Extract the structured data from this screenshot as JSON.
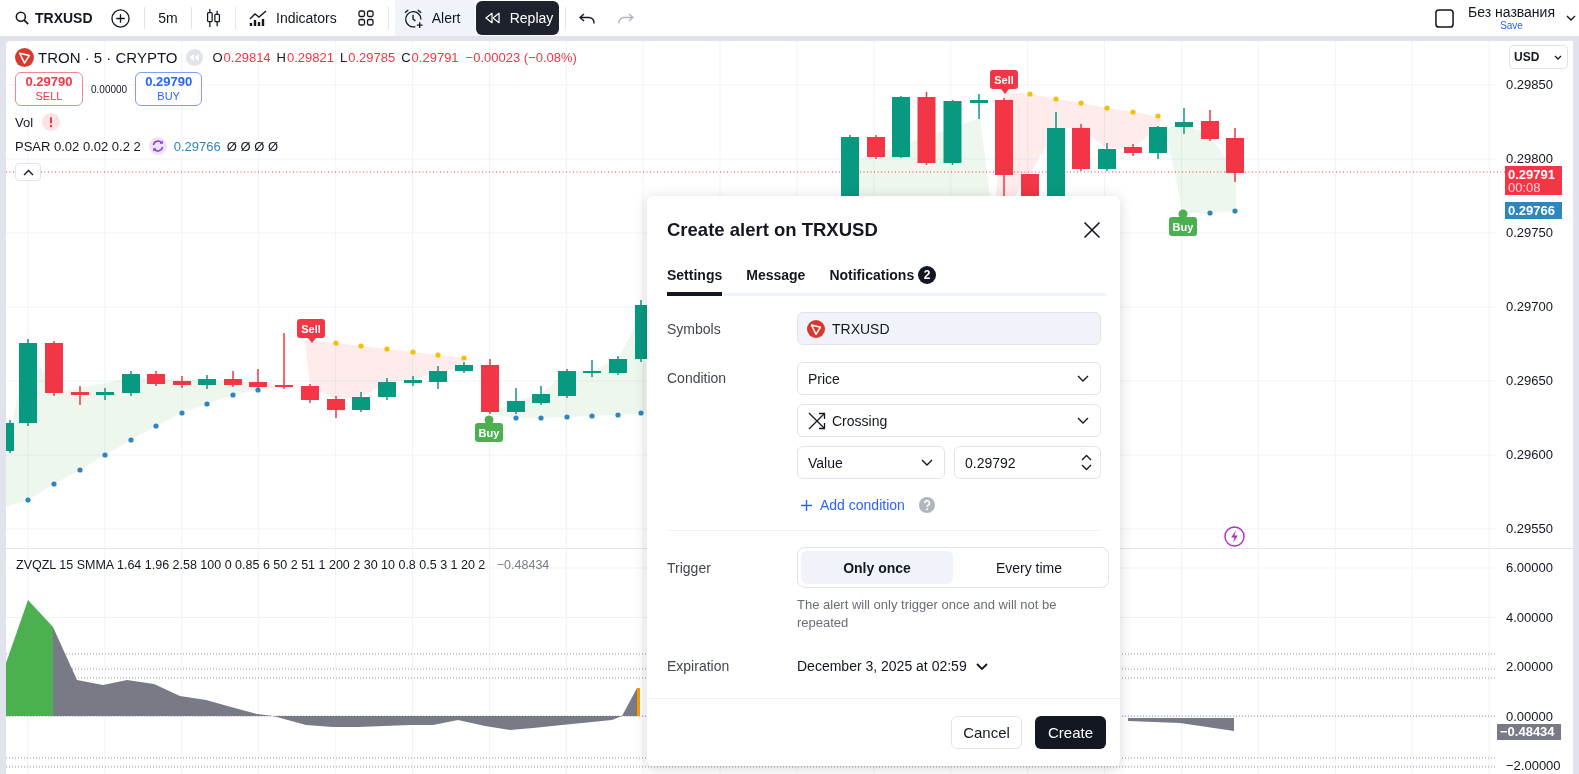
{
  "toolbar": {
    "symbol": "TRXUSD",
    "interval": "5m",
    "indicators_label": "Indicators",
    "alert": {
      "label": "Alert",
      "active": true
    },
    "replay_label": "Replay",
    "undo": {
      "disabled": false
    },
    "redo": {
      "disabled": true
    },
    "layout": {
      "name": "Без названия",
      "save_label": "Save"
    }
  },
  "legend": {
    "title": "TRON · 5 · CRYPTO",
    "ohlc": [
      {
        "key": "O",
        "value": "0.29814"
      },
      {
        "key": "H",
        "value": "0.29821"
      },
      {
        "key": "L",
        "value": "0.29785"
      },
      {
        "key": "C",
        "value": "0.29791"
      }
    ],
    "change": "−0.00023 (−0.08%)",
    "sell": {
      "price": "0.29790",
      "label": "SELL"
    },
    "spread": "0.00000",
    "buy": {
      "price": "0.29790",
      "label": "BUY"
    },
    "studies": [
      {
        "kind": "volume",
        "name": "Vol",
        "warning": true
      },
      {
        "kind": "psar",
        "name": "PSAR 0.02 0.02 0.2 2",
        "warning": false,
        "value": "0.29766",
        "extra": "Ø Ø Ø Ø"
      }
    ]
  },
  "chart": {
    "signals": [
      {
        "kind": "sell",
        "label": "Sell"
      },
      {
        "kind": "buy",
        "label": "Buy"
      },
      {
        "kind": "sell",
        "label": "Sell"
      },
      {
        "kind": "buy",
        "label": "Buy"
      }
    ]
  },
  "price_axis": {
    "currency": "USD",
    "ticks": [
      "0.29850",
      "0.29800",
      "0.29750",
      "0.29700",
      "0.29650",
      "0.29600",
      "0.29550"
    ],
    "last_price": "0.29791",
    "countdown": "00:08",
    "psar_price": "0.29766"
  },
  "oscillator": {
    "title": "ZVQZL 15 SMMA 1.64 1.96 2.58 100 0 0.85 6 50 2 51 1 200 2 30 10 0.8 0.5 3 1 20 2",
    "value": "−0.48434",
    "ticks": [
      "6.00000",
      "4.00000",
      "2.00000",
      "0.00000",
      "−2.00000"
    ],
    "value_label": "−0.48434"
  },
  "alert_dialog": {
    "title": "Create alert on TRXUSD",
    "tabs": [
      {
        "label": "Settings",
        "selected": true
      },
      {
        "label": "Message",
        "selected": false
      },
      {
        "label": "Notifications",
        "selected": false,
        "badge": "2"
      }
    ],
    "symbols": {
      "label": "Symbols",
      "value": "TRXUSD"
    },
    "condition": {
      "label": "Condition",
      "source": "Price",
      "operator": "Crossing",
      "operand_type": "Value",
      "operand_value": "0.29792",
      "add_label": "Add condition"
    },
    "trigger": {
      "label": "Trigger",
      "options": [
        {
          "label": "Only once",
          "selected": true
        },
        {
          "label": "Every time",
          "selected": false
        }
      ],
      "hint": "The alert will only trigger once and will not be repeated"
    },
    "expiration": {
      "label": "Expiration",
      "value": "December 3, 2025 at 02:59"
    },
    "buttons": [
      {
        "kind": "secondary",
        "label": "Cancel"
      },
      {
        "kind": "primary",
        "label": "Create"
      }
    ]
  }
}
